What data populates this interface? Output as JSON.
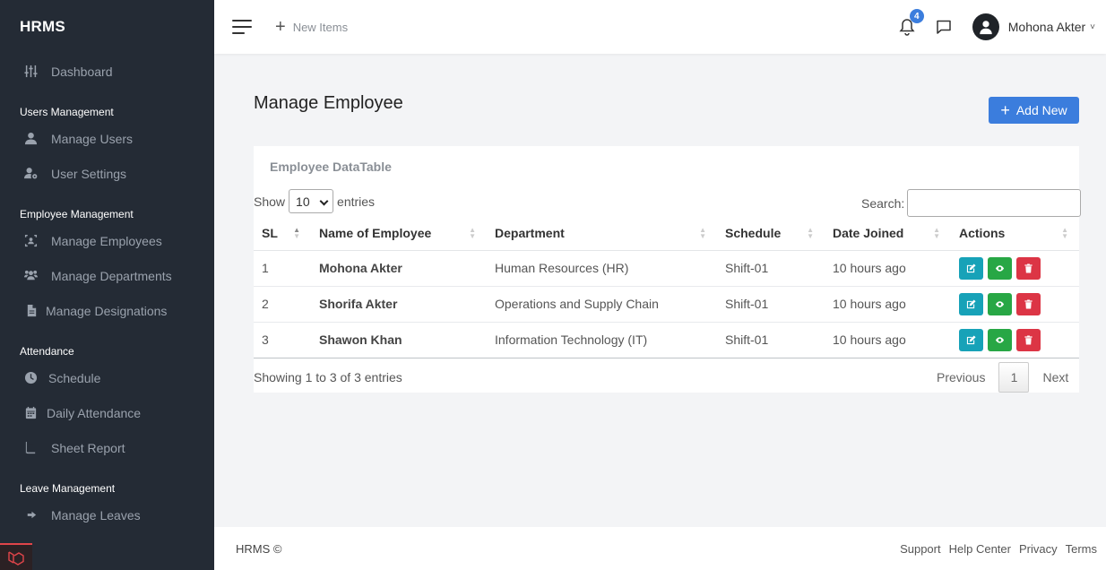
{
  "app": {
    "brand": "HRMS"
  },
  "sidebar": {
    "dashboard": {
      "label": "Dashboard",
      "icon": "sliders-icon"
    },
    "groups": [
      {
        "title": "Users Management",
        "items": [
          {
            "label": "Manage Users",
            "icon": "user-icon"
          },
          {
            "label": "User Settings",
            "icon": "user-gear-icon"
          }
        ]
      },
      {
        "title": "Employee Management",
        "items": [
          {
            "label": "Manage Employees",
            "icon": "id-badge-icon"
          },
          {
            "label": "Manage Departments",
            "icon": "users-icon"
          },
          {
            "label": "Manage Designations",
            "icon": "file-icon"
          }
        ]
      },
      {
        "title": "Attendance",
        "items": [
          {
            "label": "Schedule",
            "icon": "clock-icon"
          },
          {
            "label": "Daily Attendance",
            "icon": "calendar-icon"
          },
          {
            "label": "Sheet Report",
            "icon": "book-icon"
          }
        ]
      },
      {
        "title": "Leave Management",
        "items": [
          {
            "label": "Manage Leaves",
            "icon": "sign-out-icon"
          }
        ]
      }
    ]
  },
  "topbar": {
    "new_items": "New Items",
    "notification_count": "4",
    "user_name": "Mohona Akter"
  },
  "main": {
    "page_title": "Manage Employee",
    "add_button": "Add New",
    "card_title": "Employee DataTable",
    "length": {
      "show": "Show",
      "value": "10",
      "entries": "entries"
    },
    "search_label": "Search:",
    "columns": [
      "SL",
      "Name of Employee",
      "Department",
      "Schedule",
      "Date Joined",
      "Actions"
    ],
    "rows": [
      {
        "sl": "1",
        "name": "Mohona Akter",
        "department": "Human Resources (HR)",
        "schedule": "Shift-01",
        "joined": "10 hours ago"
      },
      {
        "sl": "2",
        "name": "Shorifa Akter",
        "department": "Operations and Supply Chain",
        "schedule": "Shift-01",
        "joined": "10 hours ago"
      },
      {
        "sl": "3",
        "name": "Shawon Khan",
        "department": "Information Technology (IT)",
        "schedule": "Shift-01",
        "joined": "10 hours ago"
      }
    ],
    "info": "Showing 1 to 3 of 3 entries",
    "pager": {
      "previous": "Previous",
      "page": "1",
      "next": "Next"
    }
  },
  "footer": {
    "copyright": "HRMS ©",
    "links": [
      "Support",
      "Help Center",
      "Privacy",
      "Terms"
    ]
  },
  "colors": {
    "sidebar_bg": "#242b35",
    "primary": "#3b7ddd",
    "edit": "#17a2b8",
    "view": "#28a745",
    "delete": "#dc3545"
  }
}
